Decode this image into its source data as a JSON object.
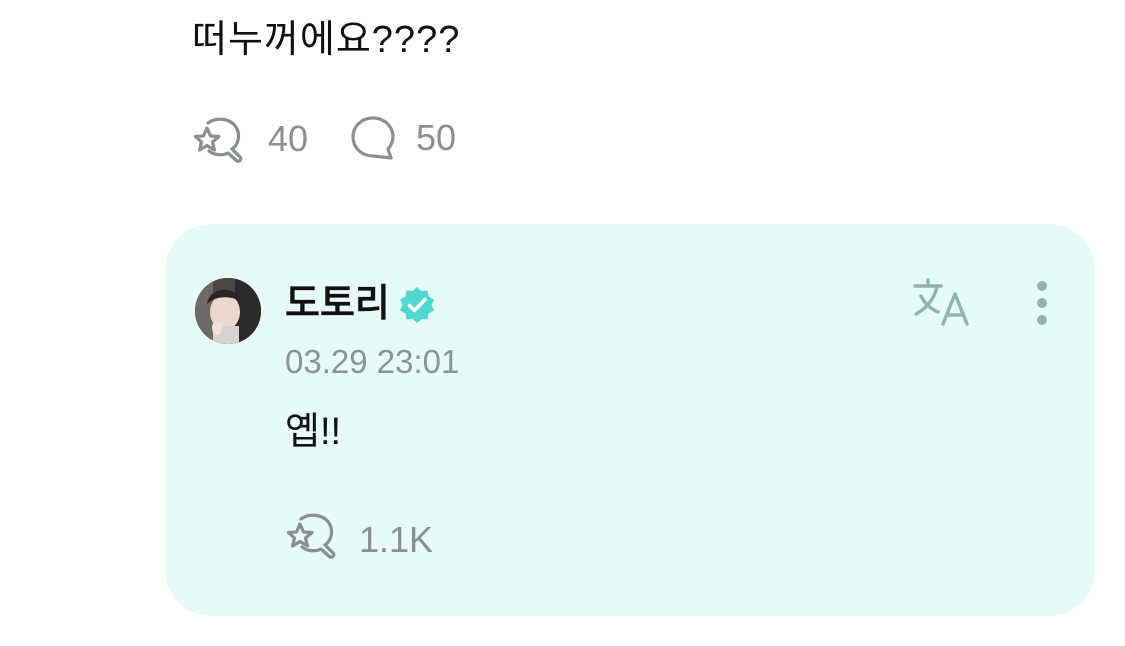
{
  "post": {
    "text": "떠누꺼에요????",
    "reactions": {
      "icon": "star-bubble-icon",
      "count": "40"
    },
    "comments": {
      "icon": "comment-bubble-icon",
      "count": "50"
    }
  },
  "reply": {
    "author": "도토리",
    "verified": true,
    "timestamp": "03.29 23:01",
    "text": "옙!!",
    "reactions": {
      "icon": "star-bubble-icon",
      "count": "1.1K"
    },
    "actions": [
      "translate-icon",
      "more-options-icon"
    ]
  },
  "colors": {
    "card_background": "#e6faf7",
    "accent": "#4fd8d0",
    "muted_text": "#8a8f93",
    "icon_teal": "#8fb5b0"
  }
}
